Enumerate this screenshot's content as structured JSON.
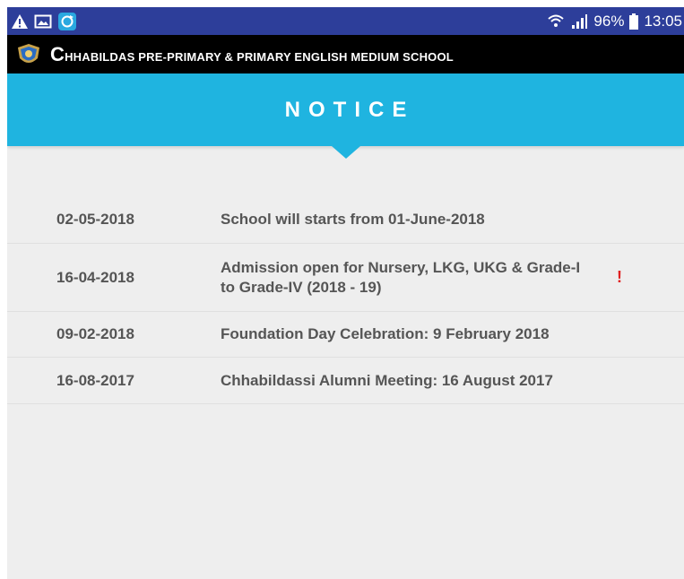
{
  "status_bar": {
    "left_icons": [
      "warning-icon",
      "gallery-icon",
      "sync-icon"
    ],
    "battery": "96%",
    "time": "13:05"
  },
  "header": {
    "school_name": "CHHABILDAS PRE-PRIMARY & PRIMARY ENGLISH MEDIUM SCHOOL",
    "logo_icon": "school-crest-icon"
  },
  "page": {
    "title": "NOTICE"
  },
  "notices": [
    {
      "date": "02-05-2018",
      "text": "School will starts from 01-June-2018",
      "flag": ""
    },
    {
      "date": "16-04-2018",
      "text": "Admission open for Nursery, LKG, UKG & Grade-I to Grade-IV (2018 - 19)",
      "flag": "!"
    },
    {
      "date": "09-02-2018",
      "text": "Foundation Day Celebration: 9 February 2018",
      "flag": ""
    },
    {
      "date": "16-08-2017",
      "text": "Chhabildassi Alumni Meeting: 16 August 2017",
      "flag": ""
    }
  ],
  "colors": {
    "status_bar": "#2d3e9a",
    "school_bar": "#000000",
    "notice_bar": "#1fb4e0",
    "background": "#eeeeee",
    "text": "#555555",
    "flag": "#e02020"
  }
}
